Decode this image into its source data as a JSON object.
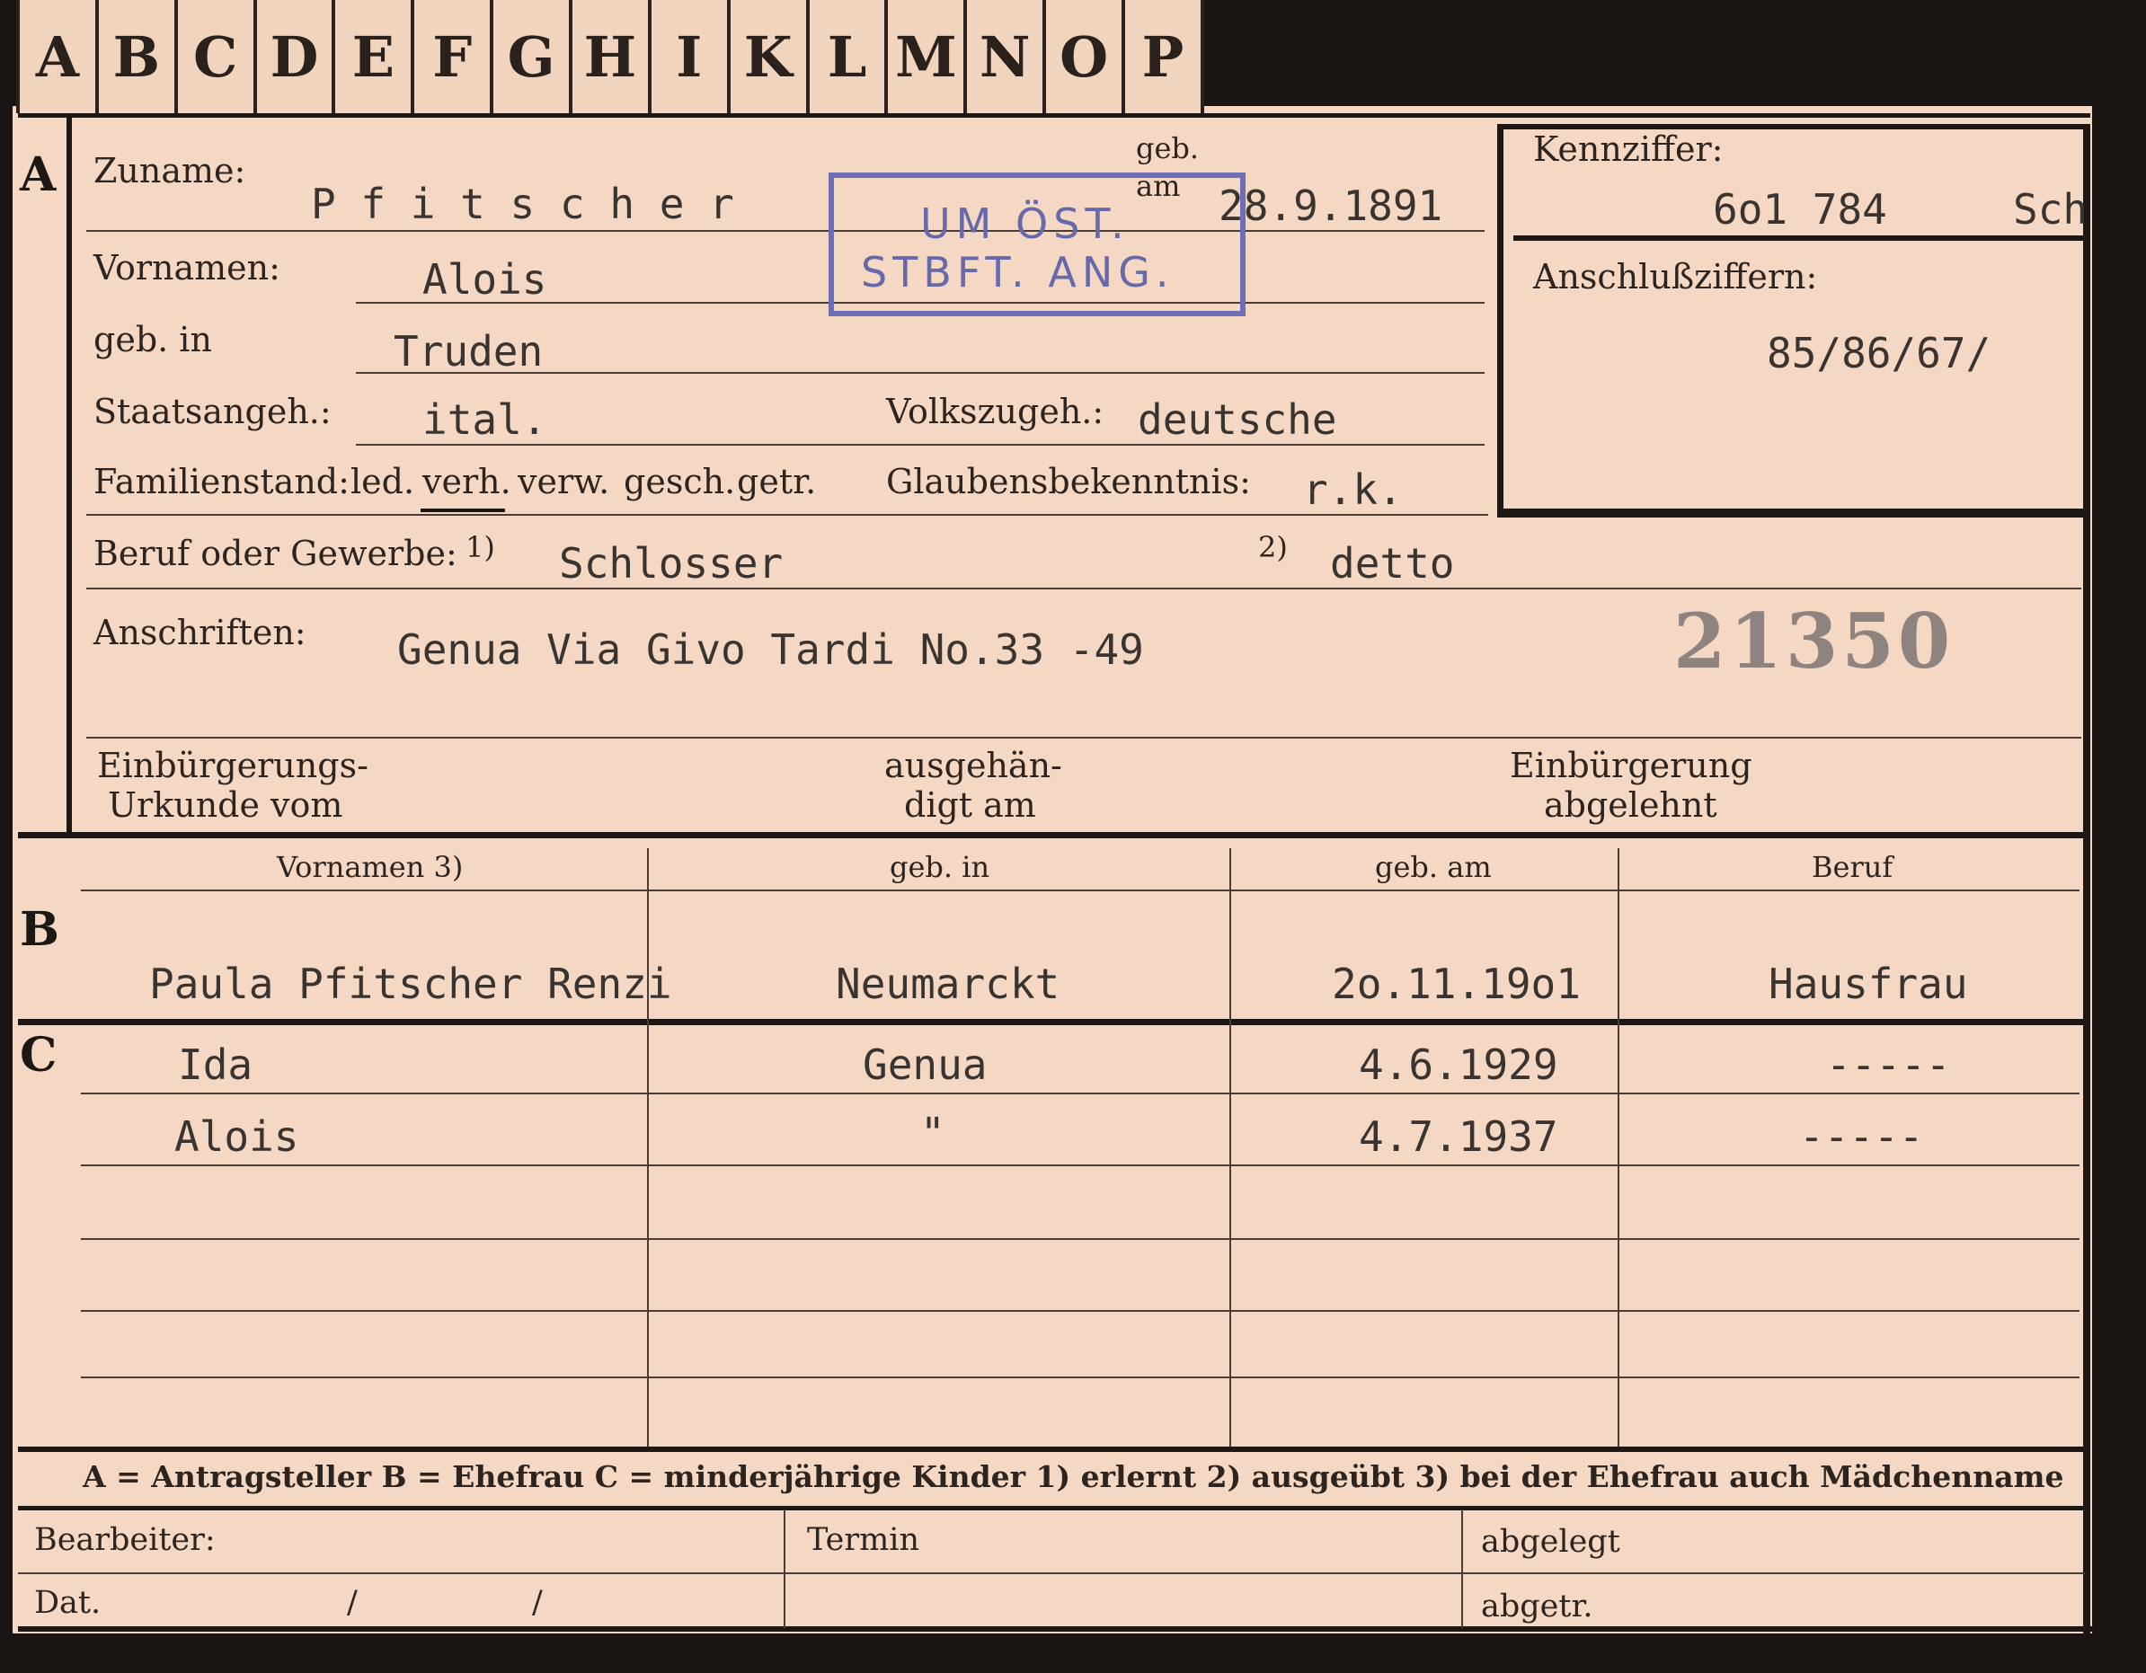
{
  "index_tabs": [
    "A",
    "B",
    "C",
    "D",
    "E",
    "F",
    "G",
    "H",
    "I",
    "K",
    "L",
    "M",
    "N",
    "O",
    "P"
  ],
  "section_a": {
    "marker": "A",
    "labels": {
      "surname": "Zuname:",
      "born_on_top": "geb.",
      "born_on_bottom": "am",
      "first_names": "Vornamen:",
      "born_in": "geb. in",
      "citizenship": "Staatsangeh.:",
      "ethnicity": "Volkszugeh.:",
      "marital_status": "Familienstand:",
      "marital_options": [
        "led.",
        "verh.",
        "verw.",
        "gesch.",
        "getr."
      ],
      "religion": "Glaubensbekenntnis:",
      "occupation": "Beruf oder Gewerbe:",
      "note1": "1)",
      "note2": "2)",
      "addresses": "Anschriften:",
      "naturalization_doc_1": "Einbürgerungs-",
      "naturalization_doc_2": "Urkunde vom",
      "delivered_1": "ausgehän-",
      "delivered_2": "digt am",
      "naturalization_refused_1": "Einbürgerung",
      "naturalization_refused_2": "abgelehnt"
    },
    "values": {
      "surname": "P f i t s c h e r",
      "born_on": "28.9.1891",
      "first_names": "Alois",
      "born_in": "Truden",
      "citizenship": "ital.",
      "ethnicity": "deutsche",
      "religion": "r.k.",
      "occupation_learned": "Schlosser",
      "occupation_practiced": "detto",
      "address": "Genua Via Givo Tardi No.33 -49",
      "stamped_number": "21350"
    },
    "stamp": {
      "line1": "UM ÖST.",
      "line2": "STBFT. ANG."
    }
  },
  "id_box": {
    "label_id": "Kennziffer:",
    "value_id": "6o1 784",
    "value_suffix": "Sch",
    "label_links": "Anschlußziffern:",
    "value_links": "85/86/67/"
  },
  "section_b": {
    "marker": "B",
    "headers": [
      "Vornamen 3)",
      "geb. in",
      "geb. am",
      "Beruf"
    ],
    "row": [
      "Paula Pfitscher Renzi",
      "Neumarckt",
      "2o.11.19o1",
      "Hausfrau"
    ]
  },
  "section_c": {
    "marker": "C",
    "rows": [
      [
        "Ida",
        "Genua",
        "4.6.1929",
        "-----"
      ],
      [
        "Alois",
        "\"",
        "4.7.1937",
        "-----"
      ]
    ]
  },
  "legend": "A = Antragsteller  B = Ehefrau  C = minderjährige Kinder  1) erlernt  2) ausgeübt  3) bei der Ehefrau auch Mädchenname",
  "footer": {
    "editor": "Bearbeiter:",
    "date": "Dat.",
    "date_sep1": "/",
    "date_sep2": "/",
    "deadline": "Termin",
    "filed": "abgelegt",
    "separated": "abgetr."
  }
}
